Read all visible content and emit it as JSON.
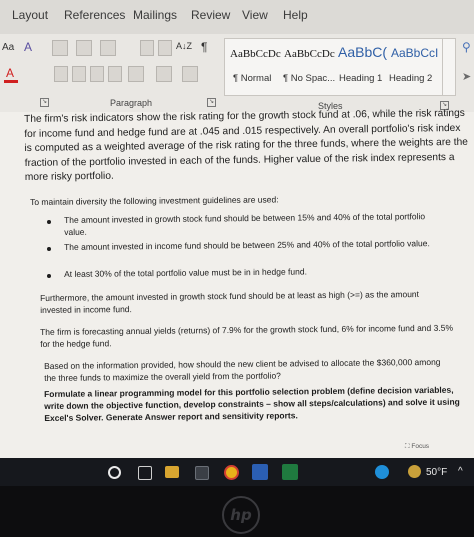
{
  "ribbon": {
    "tabs": [
      "Layout",
      "References",
      "Mailings",
      "Review",
      "View",
      "Help"
    ],
    "font_group": {
      "aa_label": "Aa",
      "font_color_label": "A"
    },
    "paragraph_group_label": "Paragraph",
    "styles_group_label": "Styles",
    "pilcrow": "¶",
    "sort_label": "A↓Z",
    "styles": [
      {
        "sample": "AaBbCcDc",
        "name": "¶ Normal"
      },
      {
        "sample": "AaBbCcDc",
        "name": "¶ No Spac..."
      },
      {
        "sample": "AaBbC(",
        "name": "Heading 1"
      },
      {
        "sample": "AaBbCcI",
        "name": "Heading 2"
      }
    ]
  },
  "document": {
    "paragraph1": "The firm's risk indicators show the risk rating for the growth stock fund at .06, while the risk ratings for income fund and hedge fund are at .045 and .015 respectively. An overall portfolio's risk index is computed as a weighted average of the risk rating for the three funds, where the weights are the fraction of the portfolio invested in each of the funds. Higher value of the risk index represents a more risky portfolio.",
    "guidelines_intro": "To maintain diversity the following investment guidelines are used:",
    "bullets": [
      "The amount invested in growth stock fund should be between 15% and 40% of the total portfolio value.",
      "The amount invested in income fund should be between 25% and 40% of the total portfolio value.",
      "At least 30% of the total portfolio value must be in in hedge fund."
    ],
    "furthermore": "Furthermore, the amount invested in growth stock fund should be at least as high (>=) as the amount invested in income fund.",
    "forecast": "The firm is forecasting annual yields (returns) of 7.9% for the growth stock fund, 6% for income fund and 3.5% for the hedge fund.",
    "question": "Based on the information provided, how should the new client be advised to allocate the $360,000 among the three funds to maximize the overall yield from the portfolio?",
    "task": "Formulate a linear programming model for this portfolio selection problem (define decision variables, write down the objective function, develop constraints – show all steps/calculations) and solve it using Excel's Solver. Generate Answer report and sensitivity reports.",
    "focus_label": "Focus"
  },
  "taskbar": {
    "weather": "50°F",
    "chevron": "^"
  },
  "device": {
    "logo_text": "hp"
  },
  "colors": {
    "heading_blue": "#2f5fa6",
    "taskbar_bg": "#16181d",
    "edge_icon": "#1f8fd9",
    "chrome_icon": "#e8b21a",
    "word_icon": "#2b5fb3",
    "excel_icon": "#1f7a3f"
  }
}
